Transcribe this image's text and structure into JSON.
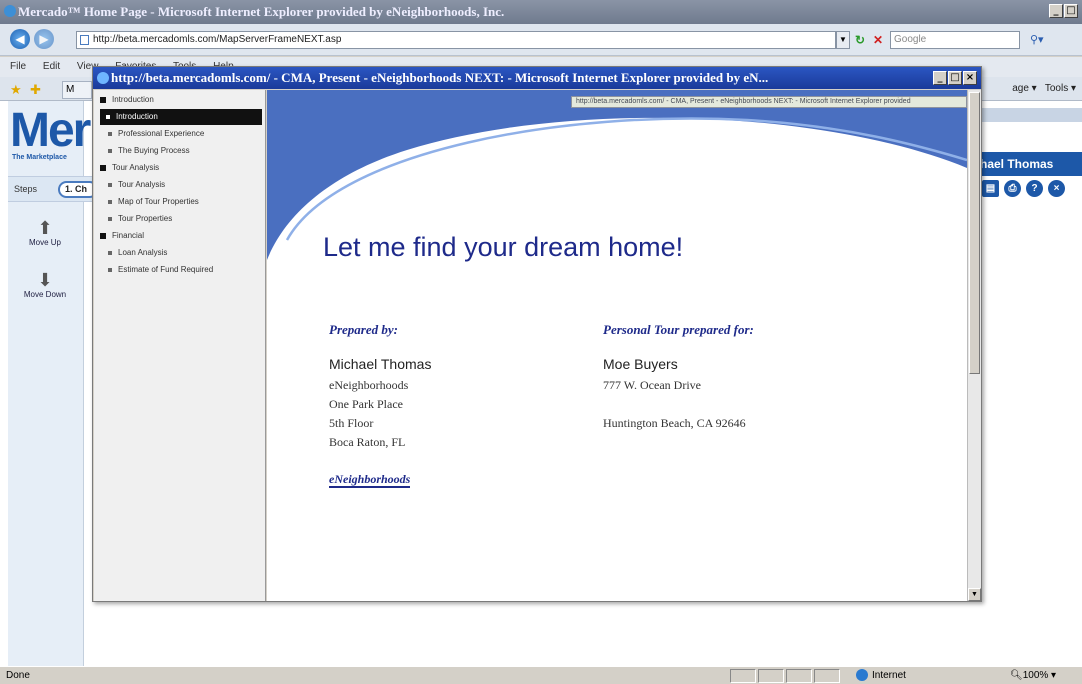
{
  "outer_window": {
    "title": "Mercado™ Home Page - Microsoft Internet Explorer provided by eNeighborhoods, Inc.",
    "min": "_",
    "max": "□",
    "close": "×"
  },
  "address_bar": {
    "back": "◀",
    "forward": "▶",
    "url": "http://beta.mercadomls.com/MapServerFrameNEXT.asp",
    "search_placeholder": "Google"
  },
  "menu": [
    "File",
    "Edit",
    "View",
    "Favorites",
    "Tools",
    "Help"
  ],
  "tools_bar": {
    "page": "age ▾",
    "tools": "Tools ▾"
  },
  "background_page": {
    "logo": "Mer",
    "tagline": "The Marketplace",
    "steps_label": "Steps",
    "step_pill": "1. Ch",
    "move_up": "Move Up",
    "move_down": "Move Down",
    "user_name": "hael Thomas"
  },
  "popup": {
    "title": "http://beta.mercadomls.com/ - CMA, Present - eNeighborhoods NEXT: - Microsoft Internet Explorer provided by eN...",
    "tooltip": "http://beta.mercadomls.com/ - CMA, Present - eNeighborhoods NEXT: - Microsoft Internet Explorer provided",
    "nav": [
      {
        "label": "Introduction",
        "type": "section"
      },
      {
        "label": "Introduction",
        "type": "selected"
      },
      {
        "label": "Professional Experience",
        "type": "item"
      },
      {
        "label": "The Buying Process",
        "type": "item"
      },
      {
        "label": "Tour Analysis",
        "type": "section"
      },
      {
        "label": "Tour Analysis",
        "type": "item"
      },
      {
        "label": "Map of Tour Properties",
        "type": "item"
      },
      {
        "label": "Tour Properties",
        "type": "item"
      },
      {
        "label": "Financial",
        "type": "section"
      },
      {
        "label": "Loan Analysis",
        "type": "item"
      },
      {
        "label": "Estimate of Fund Required",
        "type": "item"
      }
    ],
    "headline": "Let me find your dream home!",
    "prepared_by_label": "Prepared by:",
    "agent": {
      "name": "Michael Thomas",
      "company": "eNeighborhoods",
      "address1": "One Park Place",
      "address2": "5th Floor",
      "city": "Boca Raton, FL"
    },
    "prepared_for_label": "Personal Tour prepared for:",
    "client": {
      "name": "Moe Buyers",
      "address1": "777 W. Ocean Drive",
      "city": "Huntington Beach, CA 92646"
    },
    "company_logo": "eNeighborhoods",
    "colors": {
      "banner": "#4a6fc0",
      "headline": "#1e2a8a"
    }
  },
  "status_bar": {
    "text": "Done",
    "zone": "Internet",
    "zoom": "100%"
  }
}
